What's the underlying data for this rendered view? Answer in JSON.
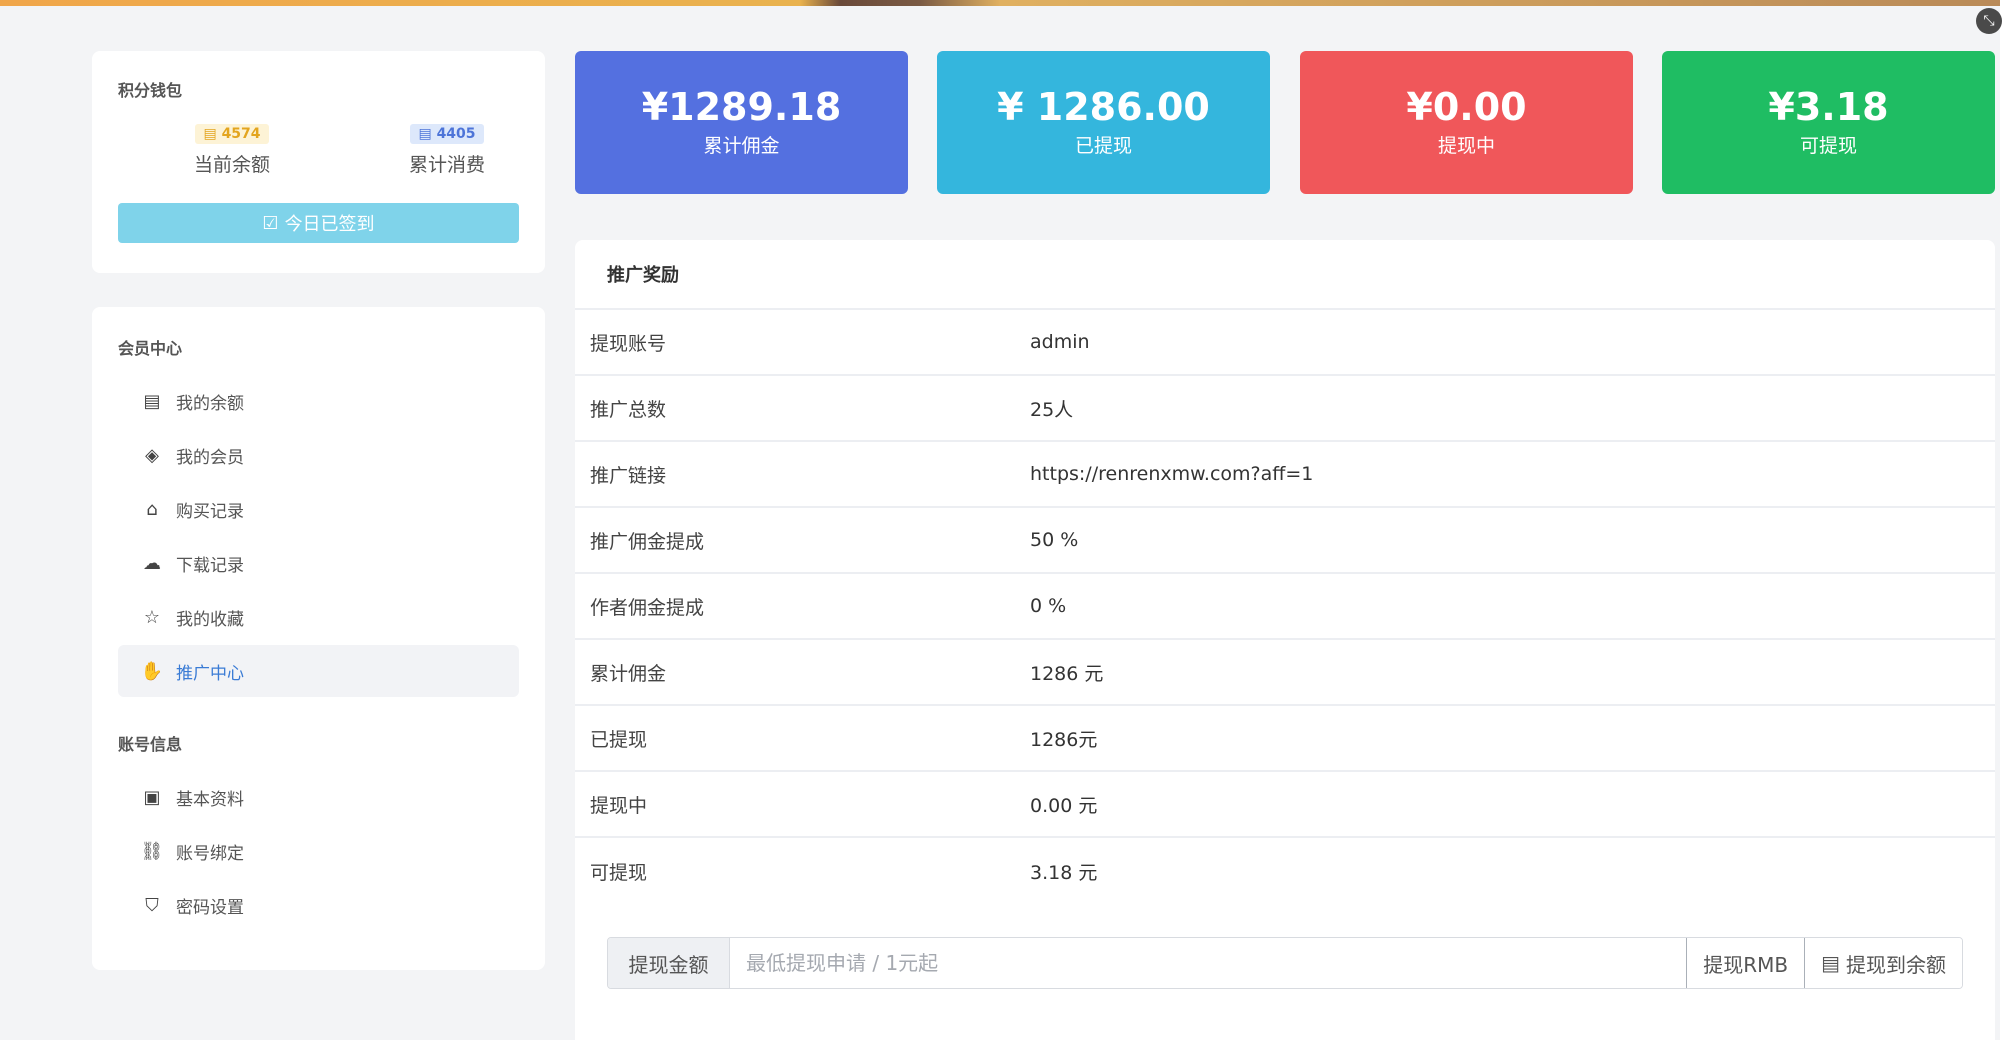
{
  "window": {
    "close_icon": "collapse-icon"
  },
  "wallet": {
    "title": "积分钱包",
    "balance_badge": "4574",
    "balance_label": "当前余额",
    "spent_badge": "4405",
    "spent_label": "累计消费",
    "signed_button": "今日已签到",
    "colors": {
      "signed_button": "#7fd3ea",
      "balance_badge": "#e3a51f",
      "spent_badge": "#4d74d8"
    }
  },
  "member": {
    "section1_title": "会员中心",
    "items": [
      {
        "label": "我的余额",
        "icon": "coins-icon"
      },
      {
        "label": "我的会员",
        "icon": "diamond-icon"
      },
      {
        "label": "购买记录",
        "icon": "basket-icon"
      },
      {
        "label": "下载记录",
        "icon": "cloud-download-icon"
      },
      {
        "label": "我的收藏",
        "icon": "star-icon"
      },
      {
        "label": "推广中心",
        "icon": "hand-coin-icon",
        "active": true
      }
    ],
    "section2_title": "账号信息",
    "account_items": [
      {
        "label": "基本资料",
        "icon": "id-card-icon"
      },
      {
        "label": "账号绑定",
        "icon": "bind-icon"
      },
      {
        "label": "密码设置",
        "icon": "shield-icon"
      }
    ]
  },
  "stats": [
    {
      "value": "¥1289.18",
      "label": "累计佣金",
      "color": "#5470e0"
    },
    {
      "value": "¥ 1286.00",
      "label": "已提现",
      "color": "#34b6dd"
    },
    {
      "value": "¥0.00",
      "label": "提现中",
      "color": "#f0575a"
    },
    {
      "value": "¥3.18",
      "label": "可提现",
      "color": "#1fbd63"
    }
  ],
  "promo": {
    "title": "推广奖励",
    "rows": [
      {
        "key": "提现账号",
        "value": "admin"
      },
      {
        "key": "推广总数",
        "value": "25人"
      },
      {
        "key": "推广链接",
        "value": "https://renrenxmw.com?aff=1"
      },
      {
        "key": "推广佣金提成",
        "value": "50 %"
      },
      {
        "key": "作者佣金提成",
        "value": "0 %"
      },
      {
        "key": "累计佣金",
        "value": "1286 元"
      },
      {
        "key": "已提现",
        "value": "1286元"
      },
      {
        "key": "提现中",
        "value": "0.00 元"
      },
      {
        "key": "可提现",
        "value": "3.18 元"
      }
    ],
    "withdraw": {
      "label": "提现金额",
      "placeholder": "最低提现申请 / 1元起",
      "value": "",
      "btn_rmb": "提现RMB",
      "btn_balance": "提现到余额"
    }
  }
}
